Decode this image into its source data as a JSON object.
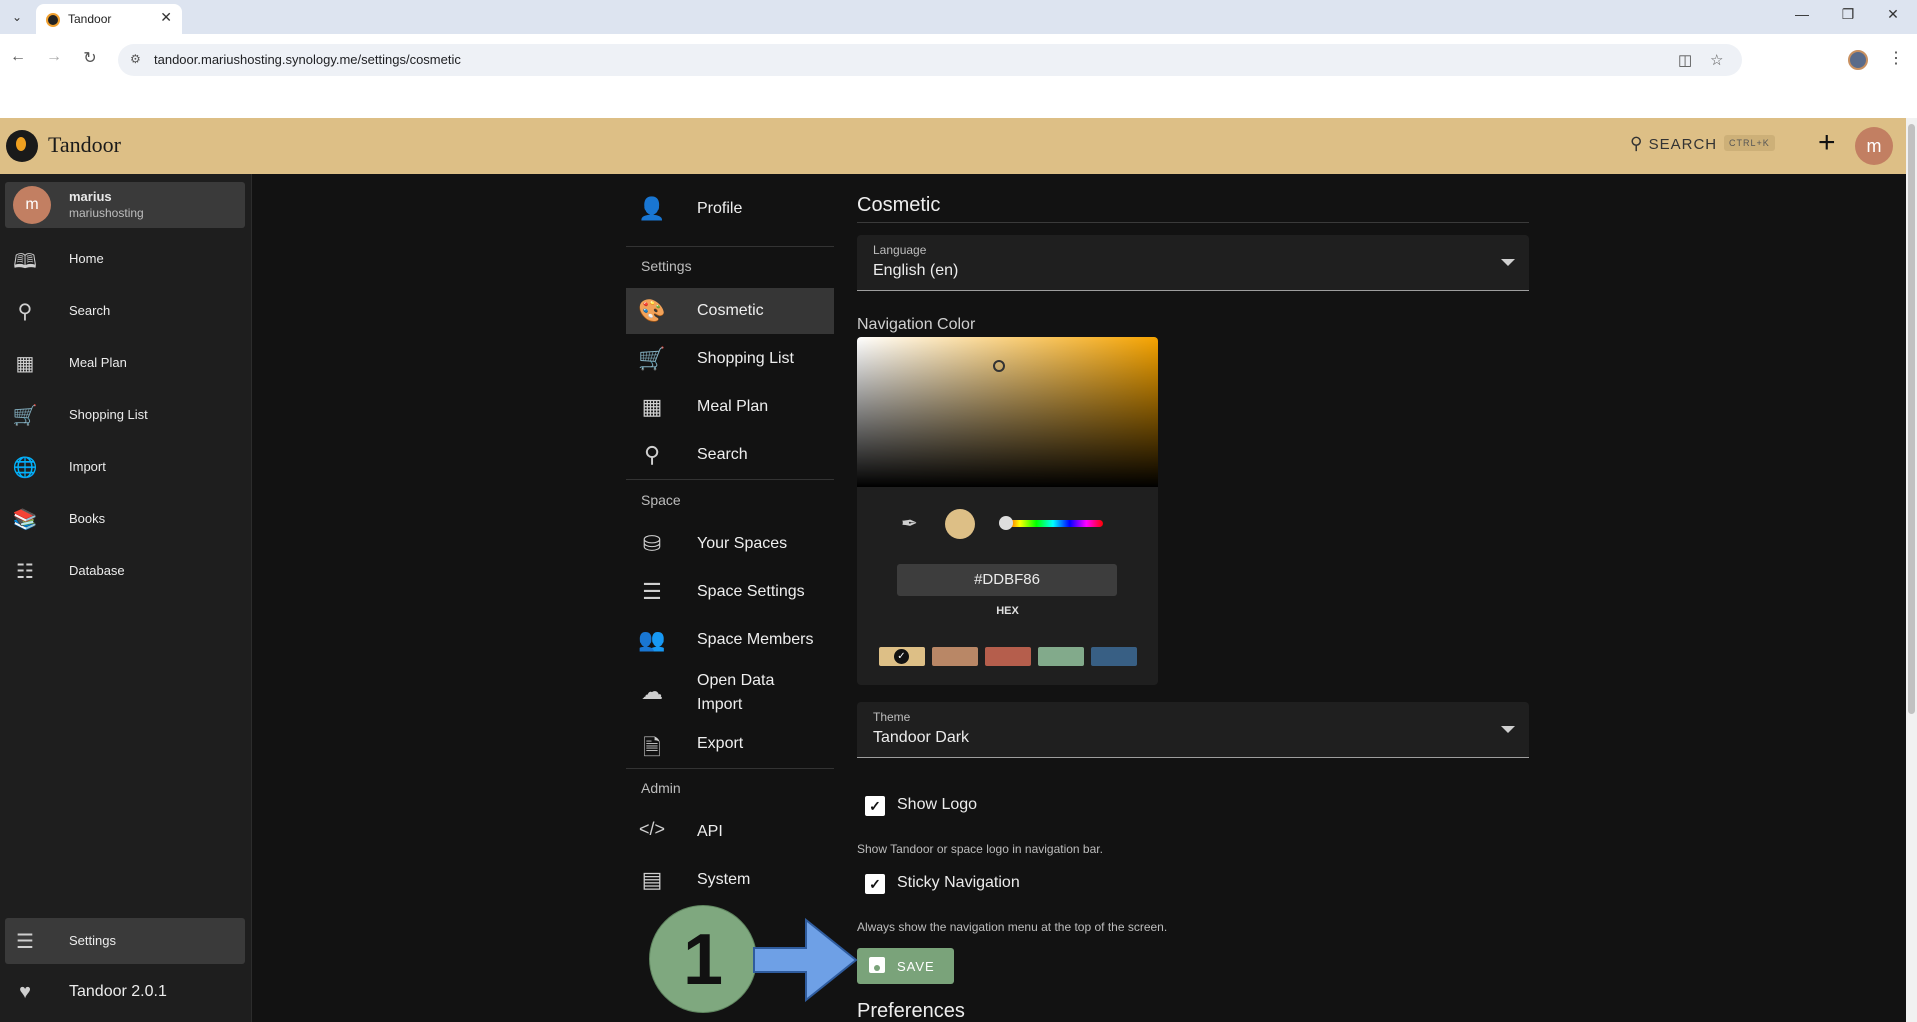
{
  "browser": {
    "tab_title": "Tandoor",
    "url": "tandoor.mariushosting.synology.me/settings/cosmetic"
  },
  "header": {
    "app_name": "Tandoor",
    "search_label": "SEARCH",
    "search_shortcut": "CTRL+K",
    "avatar_letter": "m",
    "nav_color": "#DDBF86"
  },
  "drawer": {
    "user": {
      "avatar_letter": "m",
      "name": "marius",
      "space": "mariushosting"
    },
    "items": [
      {
        "label": "Home",
        "icon": "book-icon"
      },
      {
        "label": "Search",
        "icon": "search-icon"
      },
      {
        "label": "Meal Plan",
        "icon": "calendar-icon"
      },
      {
        "label": "Shopping List",
        "icon": "cart-icon"
      },
      {
        "label": "Import",
        "icon": "globe-icon"
      },
      {
        "label": "Books",
        "icon": "bookshelf-icon"
      },
      {
        "label": "Database",
        "icon": "database-tree-icon"
      }
    ],
    "bottom": [
      {
        "label": "Settings",
        "icon": "sliders-icon"
      },
      {
        "label": "Tandoor 2.0.1",
        "icon": "heart-icon"
      }
    ]
  },
  "settings_menu": {
    "profile": "Profile",
    "section_settings": "Settings",
    "settings_items": [
      "Cosmetic",
      "Shopping List",
      "Meal Plan",
      "Search"
    ],
    "section_space": "Space",
    "space_items": [
      "Your Spaces",
      "Space Settings",
      "Space Members",
      "Open Data Import",
      "Export"
    ],
    "section_admin": "Admin",
    "admin_items": [
      "API",
      "System"
    ]
  },
  "cosmetic": {
    "title": "Cosmetic",
    "language_label": "Language",
    "language_value": "English (en)",
    "nav_color_label": "Navigation Color",
    "hex_value": "#DDBF86",
    "hex_mode": "HEX",
    "presets": [
      "#ddbf86",
      "#b98766",
      "#b55e4c",
      "#82aa8b",
      "#385f84"
    ],
    "theme_label": "Theme",
    "theme_value": "Tandoor Dark",
    "show_logo_label": "Show Logo",
    "show_logo_hint": "Show Tandoor or space logo in navigation bar.",
    "sticky_nav_label": "Sticky Navigation",
    "sticky_nav_hint": "Always show the navigation menu at the top of the screen.",
    "save_label": "SAVE",
    "preferences_title": "Preferences"
  },
  "annotation": {
    "number": "1"
  }
}
